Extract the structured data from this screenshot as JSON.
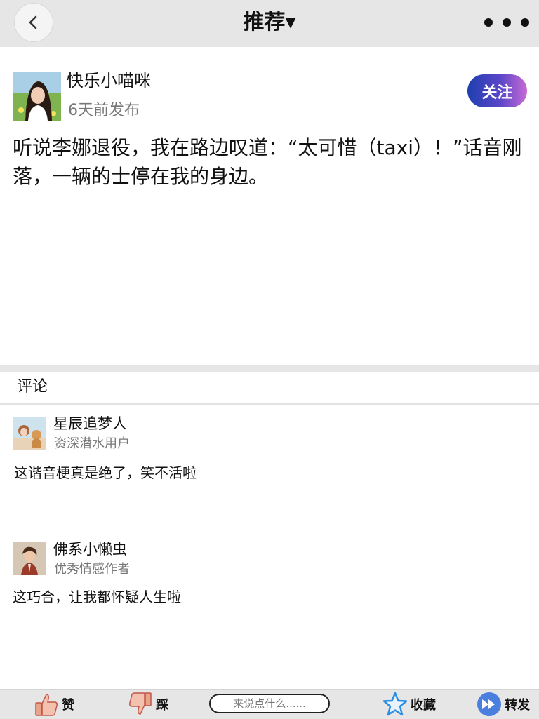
{
  "header": {
    "title": "推荐▾",
    "back_icon": "chevron-left-icon",
    "more_icon": "more-dots-icon"
  },
  "post": {
    "author": "快乐小喵咪",
    "time": "6天前发布",
    "follow_label": "关注",
    "text": "听说李娜退役，我在路边叹道：“太可惜（taxi）！”话音刚落，一辆的士停在我的身边。"
  },
  "comments": {
    "header": "评论",
    "items": [
      {
        "name": "星辰追梦人",
        "role": "资深潜水用户",
        "text": "这谐音梗真是绝了，笑不活啦"
      },
      {
        "name": "佛系小懒虫",
        "role": "优秀情感作者",
        "text": "这巧合，让我都怀疑人生啦"
      }
    ]
  },
  "bottom_bar": {
    "like_label": "赞",
    "dislike_label": "踩",
    "comment_placeholder": "来说点什么......",
    "favorite_label": "收藏",
    "share_label": "转发"
  },
  "colors": {
    "follow_gradient_start": "#1f3fb0",
    "follow_gradient_end": "#c86ad6",
    "star_blue": "#2a8de6",
    "share_blue": "#4a7fe0"
  }
}
